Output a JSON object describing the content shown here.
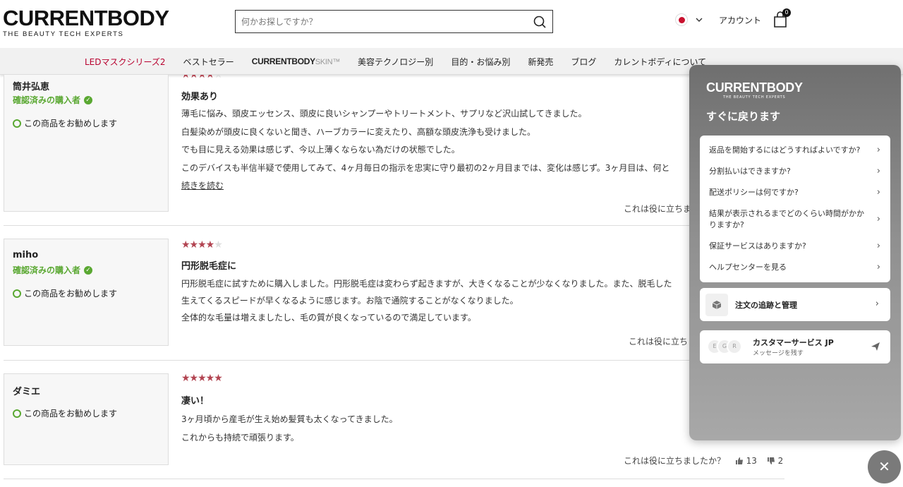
{
  "header": {
    "logo_main": "CURRENTBODY",
    "logo_sub": "THE BEAUTY TECH EXPERTS",
    "search_placeholder": "何かお探しですか？",
    "account_label": "アカウント",
    "cart_count": "0"
  },
  "nav": {
    "items": [
      "LEDマスクシリーズ2",
      "ベストセラー",
      "CURRENTBODY",
      "SKIN™",
      "美容テクノロジー別",
      "目的・お悩み別",
      "新発売",
      "ブログ",
      "カレントボディについて"
    ]
  },
  "reviews": [
    {
      "name": "筒井弘恵",
      "verified": "確認済みの購入者",
      "recommend": "この商品をお勧めします",
      "rating": 4,
      "title": "効果あり",
      "lines": [
        "薄毛に悩み、頭皮エッセンス、頭皮に良いシャンプーやトリートメント、サプリなど沢山試してきました。",
        "白髪染めが頭皮に良くないと聞き、ハーブカラーに変えたり、高額な頭皮洗浄も受けました。",
        "でも目に見える効果は感じず、今以上薄くならない為だけの状態でした。",
        "このデバイスも半信半疑で使用してみて、4ヶ月毎日の指示を忠実に守り最初の2ヶ月目までは、変化は感じず。3ヶ月目は、何と"
      ],
      "read_more": "続きを読む",
      "helpful": "これは役に立ちま"
    },
    {
      "name": "miho",
      "verified": "確認済みの購入者",
      "recommend": "この商品をお勧めします",
      "rating": 4,
      "title": "円形脱毛症に",
      "lines": [
        "円形脱毛症に試すために購入しました。円形脱毛症は変わらず起きますが、大きくなることが少なくなりました。また、脱毛した",
        "生えてくるスピードが早くなるように感じます。お陰で通院することがなくなりました。",
        "全体的な毛量は増えましたし、毛の質が良くなっているので満足しています。"
      ],
      "helpful": "これは役に立ち"
    },
    {
      "name": "ダミエ",
      "recommend": "この商品をお勧めします",
      "rating": 5,
      "title": "凄い！",
      "lines": [
        "3ヶ月頃から産毛が生え始め髪質も太くなってきました。",
        "これからも持続で頑張ります。"
      ],
      "helpful": "これは役に立ちましたか？",
      "helpful_yes": "13",
      "helpful_no": "2"
    }
  ],
  "help_widget": {
    "logo_main": "CURRENTBODY",
    "logo_sub": "THE BEAUTY TECH EXPERTS",
    "title": "すぐに戻ります",
    "faq": [
      "返品を開始するにはどうすればよいですか?",
      "分割払いはできますか?",
      "配送ポリシーは何ですか?",
      "結果が表示されるまでどのくらい時間がかかりますか?",
      "保証サービスはありますか?",
      "ヘルプセンターを見る"
    ],
    "track_order": "注文の追跡と管理",
    "cs_title": "カスタマーサービス JP",
    "cs_sub": "メッセージを残す",
    "avatars": [
      "E",
      "G",
      "R"
    ]
  },
  "colors": {
    "brand_red": "#b8002e",
    "verified_green": "#5aa832",
    "star": "#b24451"
  }
}
